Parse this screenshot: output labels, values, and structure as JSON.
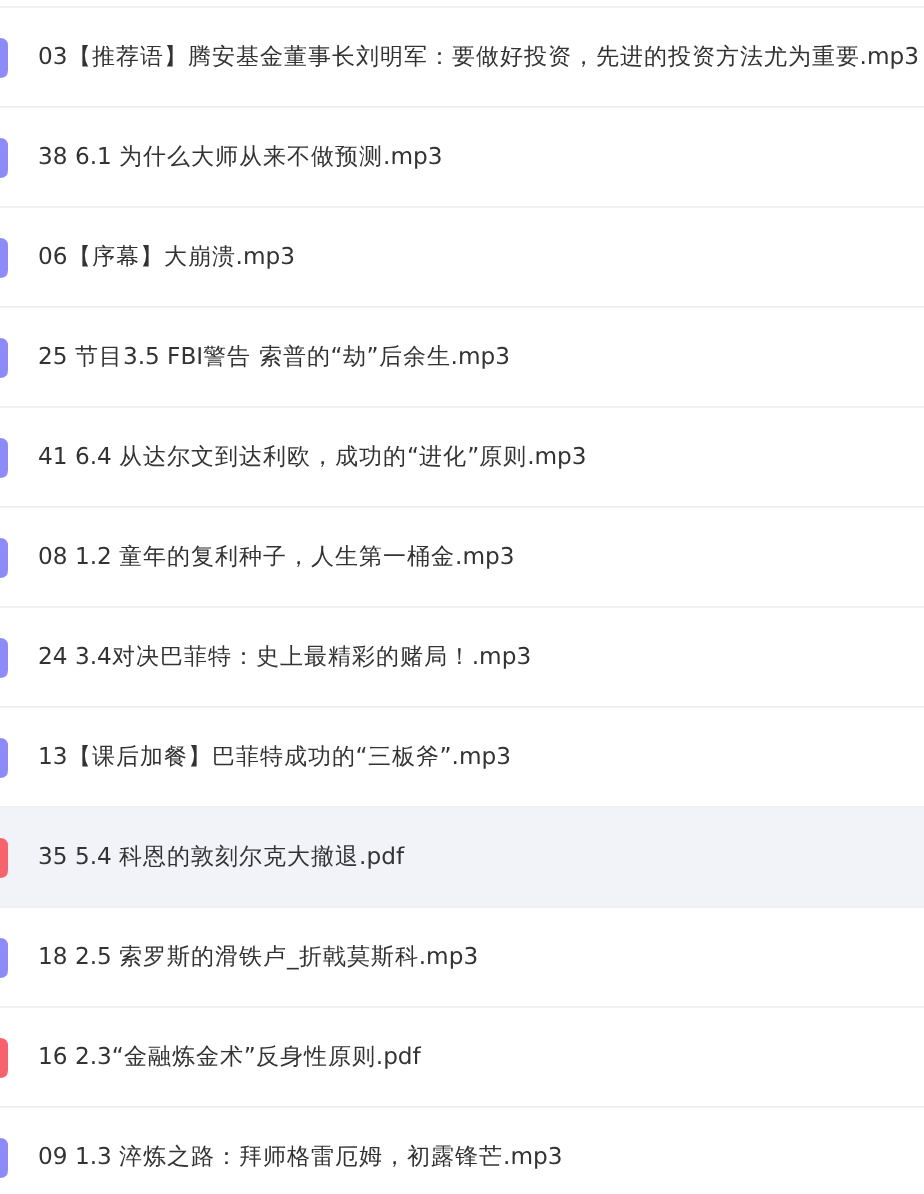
{
  "files": [
    {
      "name": "03【推荐语】腾安基金董事长刘明军：要做好投资，先进的投资方法尤为重要.mp3",
      "kind": "audio",
      "selected": false
    },
    {
      "name": "38 6.1 为什么大师从来不做预测.mp3",
      "kind": "audio",
      "selected": false
    },
    {
      "name": "06【序幕】大崩溃.mp3",
      "kind": "audio",
      "selected": false
    },
    {
      "name": "25 节目3.5 FBI警告 索普的“劫”后余生.mp3",
      "kind": "audio",
      "selected": false
    },
    {
      "name": "41 6.4 从达尔文到达利欧，成功的“进化”原则.mp3",
      "kind": "audio",
      "selected": false
    },
    {
      "name": "08 1.2 童年的复利种子，人生第一桶金.mp3",
      "kind": "audio",
      "selected": false
    },
    {
      "name": "24 3.4对决巴菲特：史上最精彩的赌局！.mp3",
      "kind": "audio",
      "selected": false
    },
    {
      "name": "13【课后加餐】巴菲特成功的“三板斧”.mp3",
      "kind": "audio",
      "selected": false
    },
    {
      "name": "35 5.4 科恩的敦刻尔克大撤退.pdf",
      "kind": "pdf",
      "selected": true
    },
    {
      "name": "18 2.5 索罗斯的滑铁卢_折戟莫斯科.mp3",
      "kind": "audio",
      "selected": false
    },
    {
      "name": "16 2.3“金融炼金术”反身性原则.pdf",
      "kind": "pdf",
      "selected": false
    },
    {
      "name": "09 1.3 淬炼之路：拜师格雷厄姆，初露锋芒.mp3",
      "kind": "audio",
      "selected": false
    }
  ]
}
